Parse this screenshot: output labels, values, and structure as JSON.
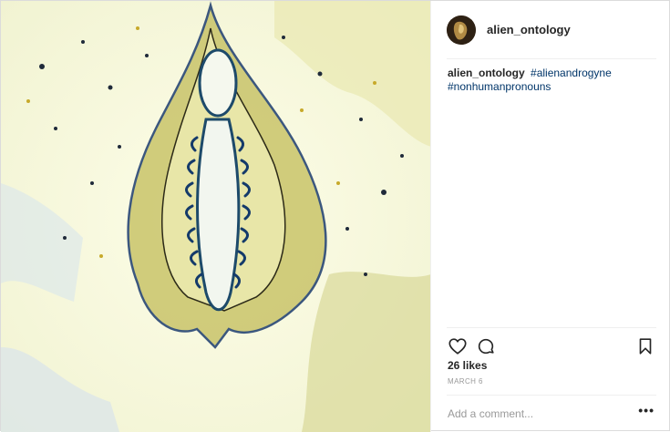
{
  "post": {
    "username": "alien_ontology",
    "caption": {
      "username": "alien_ontology",
      "hashtag_1": "#alienandrogyne",
      "hashtag_2": "#nonhumanpronouns"
    },
    "likes": "26 likes",
    "date": "MARCH 6",
    "comment_placeholder": "Add a comment...",
    "more_label": "•••"
  },
  "icons": {
    "like": "heart-icon",
    "comment": "comment-bubble-icon",
    "save": "bookmark-icon",
    "more": "more-options-icon"
  },
  "colors": {
    "hashtag": "#003569",
    "text": "#262626",
    "muted": "#999999",
    "divider": "#efefef"
  }
}
